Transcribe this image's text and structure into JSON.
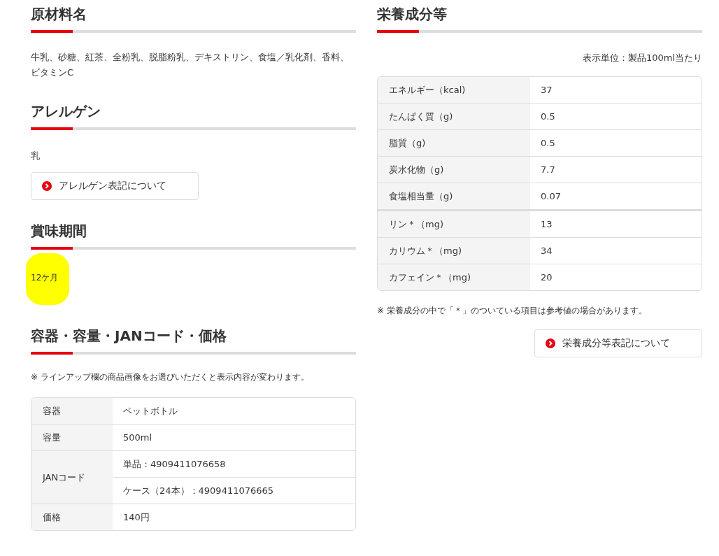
{
  "ingredients": {
    "title": "原材料名",
    "text": "牛乳、砂糖、紅茶、全粉乳、脱脂粉乳、デキストリン、食塩／乳化剤、香料、ビタミンC"
  },
  "allergens": {
    "title": "アレルゲン",
    "text": "乳",
    "link": "アレルゲン表記について"
  },
  "shelf_life": {
    "title": "賞味期間",
    "text": "12ケ月",
    "highlighted": true
  },
  "package": {
    "title": "容器・容量・JANコード・価格",
    "note": "※ ラインアップ欄の商品画像をお選びいただくと表示内容が変わります。",
    "rows": [
      {
        "label": "容器",
        "values": [
          "ペットボトル"
        ]
      },
      {
        "label": "容量",
        "values": [
          "500ml"
        ]
      },
      {
        "label": "JANコード",
        "values": [
          "単品：4909411076658",
          "ケース（24本）：4909411076665"
        ]
      },
      {
        "label": "価格",
        "values": [
          "140円"
        ]
      }
    ]
  },
  "nutrition": {
    "title": "栄養成分等",
    "unit": "表示単位：製品100ml当たり",
    "groups": [
      [
        {
          "label": "エネルギー（kcal)",
          "value": "37"
        },
        {
          "label": "たんぱく質（g)",
          "value": "0.5"
        },
        {
          "label": "脂質（g)",
          "value": "0.5"
        },
        {
          "label": "炭水化物（g)",
          "value": "7.7"
        },
        {
          "label": "食塩相当量（g)",
          "value": "0.07"
        }
      ],
      [
        {
          "label": "リン＊（mg)",
          "value": "13"
        },
        {
          "label": "カリウム＊（mg)",
          "value": "34"
        },
        {
          "label": "カフェイン＊（mg)",
          "value": "20"
        }
      ]
    ],
    "note": "※ 栄養成分の中で「＊」のついている項目は参考値の場合があります。",
    "link": "栄養成分等表記について"
  }
}
